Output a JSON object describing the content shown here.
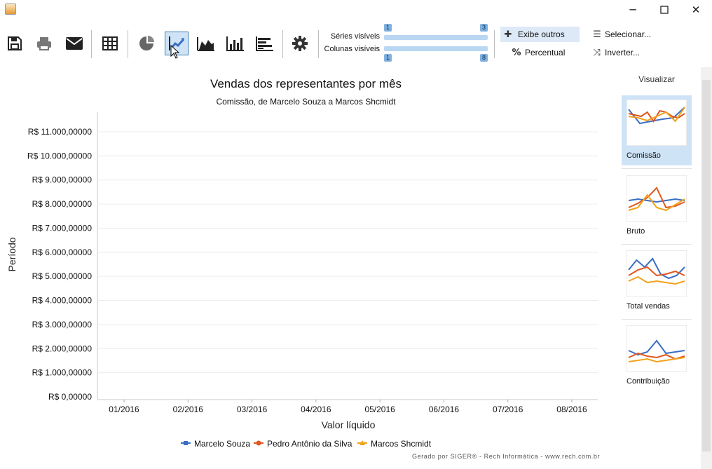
{
  "window": {
    "min_symbol": "─",
    "max_symbol": "☐",
    "close_symbol": "✕"
  },
  "toolbar": {
    "buttons": [
      {
        "icon": "save-icon"
      },
      {
        "icon": "print-icon"
      },
      {
        "icon": "email-icon"
      },
      {
        "icon": "table-icon"
      },
      {
        "icon": "pie-chart-icon"
      },
      {
        "icon": "line-chart-icon",
        "active": true
      },
      {
        "icon": "area-chart-icon"
      },
      {
        "icon": "column-chart-icon"
      },
      {
        "icon": "bar-chart-icon"
      },
      {
        "icon": "gear-icon"
      }
    ],
    "series_label": "Séries visíveis",
    "columns_label": "Colunas visíveis",
    "series_min": "1",
    "series_max": "3",
    "columns_min": "1",
    "columns_max": "8",
    "show_others_label": "Exibe outros",
    "percent_label": "Percentual",
    "select_label": "Selecionar...",
    "invert_label": "Inverter..."
  },
  "chart_data": {
    "type": "line",
    "title": "Vendas dos representantes por mês",
    "subtitle": "Comissão, de Marcelo Souza a Marcos Shcmidt",
    "xlabel": "Valor líquido",
    "ylabel": "Período",
    "categories": [
      "01/2016",
      "02/2016",
      "03/2016",
      "04/2016",
      "05/2016",
      "06/2016",
      "07/2016",
      "08/2016"
    ],
    "y_ticks": [
      "R$ 0,00000",
      "R$ 1.000,00000",
      "R$ 2.000,00000",
      "R$ 3.000,00000",
      "R$ 4.000,00000",
      "R$ 5.000,00000",
      "R$ 6.000,00000",
      "R$ 7.000,00000",
      "R$ 8.000,00000",
      "R$ 9.000,00000",
      "R$ 10.000,00000",
      "R$ 11.000,00000"
    ],
    "ylim": [
      0,
      11000
    ],
    "grid": true,
    "legend_position": "bottom",
    "series": [
      {
        "name": "Marcelo Souza",
        "color": "#3a6fc4",
        "values": []
      },
      {
        "name": "Pedro Antônio da Silva",
        "color": "#e0571f",
        "values": []
      },
      {
        "name": "Marcos Shcmidt",
        "color": "#f2a21b",
        "values": []
      }
    ]
  },
  "side_panel": {
    "title": "Visualizar",
    "thumbnails": [
      {
        "label": "Comissão",
        "selected": true
      },
      {
        "label": "Bruto",
        "selected": false
      },
      {
        "label": "Total vendas",
        "selected": false
      },
      {
        "label": "Contribuição",
        "selected": false
      }
    ]
  },
  "footer": {
    "credit": "Gerado por SIGER® - Rech Informática - www.rech.com.br"
  }
}
